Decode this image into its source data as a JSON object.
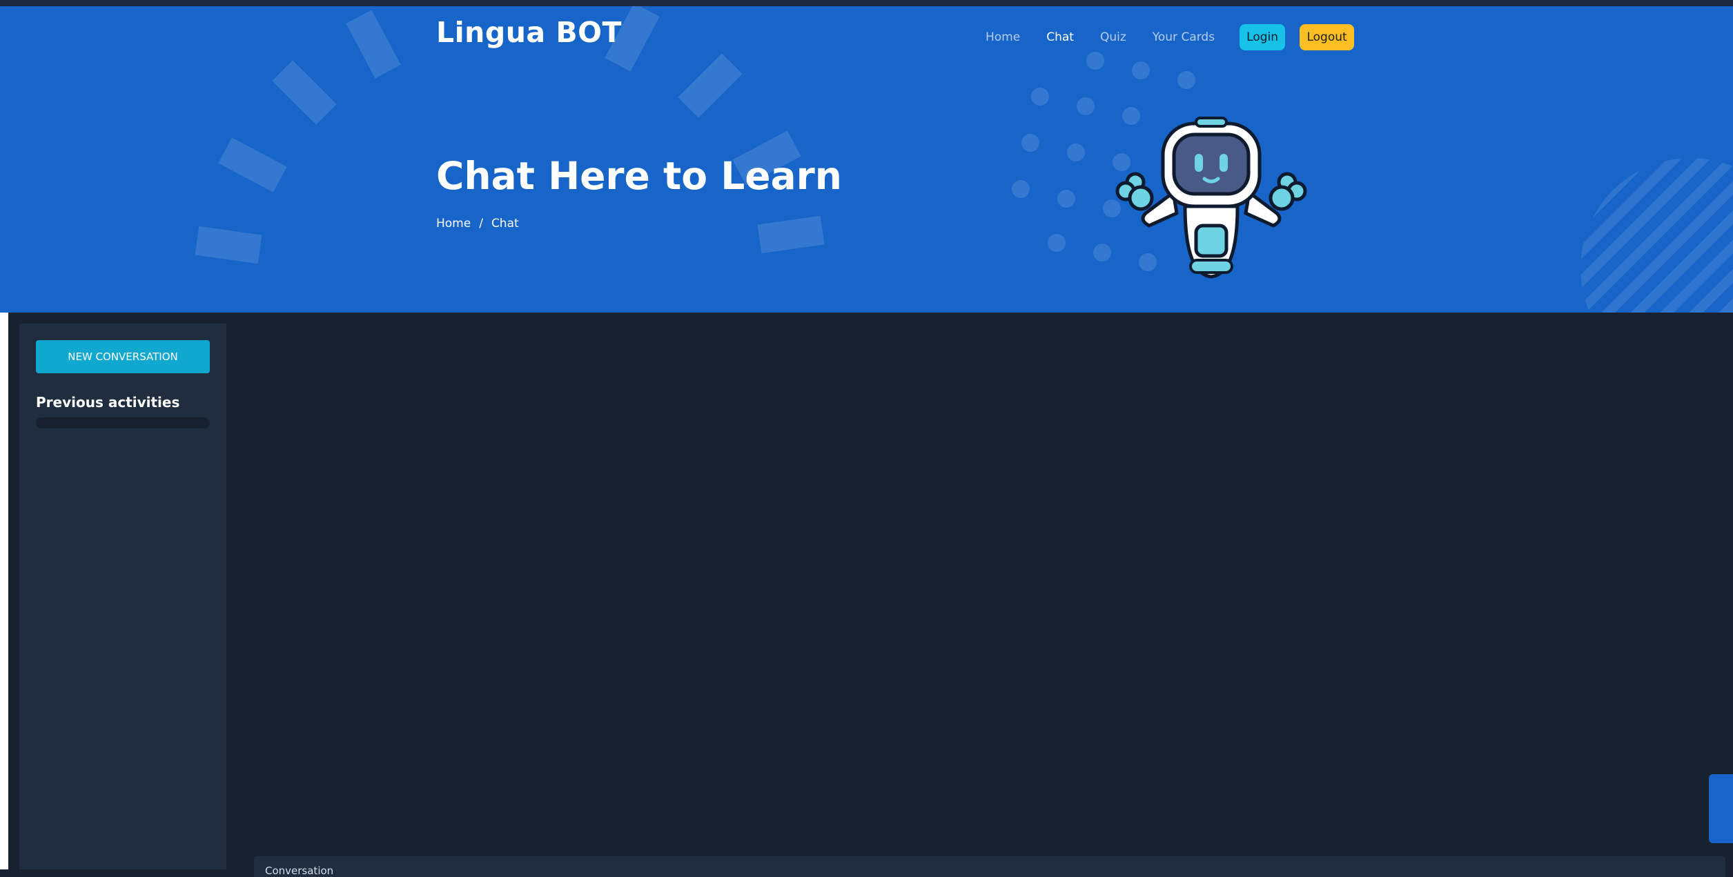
{
  "brand": {
    "name": "Lingua BOT"
  },
  "nav": {
    "items": [
      {
        "label": "Home"
      },
      {
        "label": "Chat",
        "active": true
      },
      {
        "label": "Quiz"
      },
      {
        "label": "Your Cards"
      }
    ],
    "login_label": "Login",
    "logout_label": "Logout"
  },
  "hero": {
    "title": "Chat Here to Learn",
    "breadcrumb": {
      "home": "Home",
      "separator": "/",
      "current": "Chat"
    },
    "illustration": "robot-mascot"
  },
  "sidebar": {
    "new_conversation_label": "NEW CONVERSATION",
    "previous_title": "Previous activities"
  },
  "chat": {
    "panel_label": "Conversation"
  },
  "colors": {
    "hero_bg": "#1765c9",
    "page_bg": "#18212f",
    "sidebar_bg": "#1f2d3f",
    "accent_cyan": "#11a8cf",
    "login_bg": "#16c2e8",
    "logout_bg": "#fbbf24"
  }
}
